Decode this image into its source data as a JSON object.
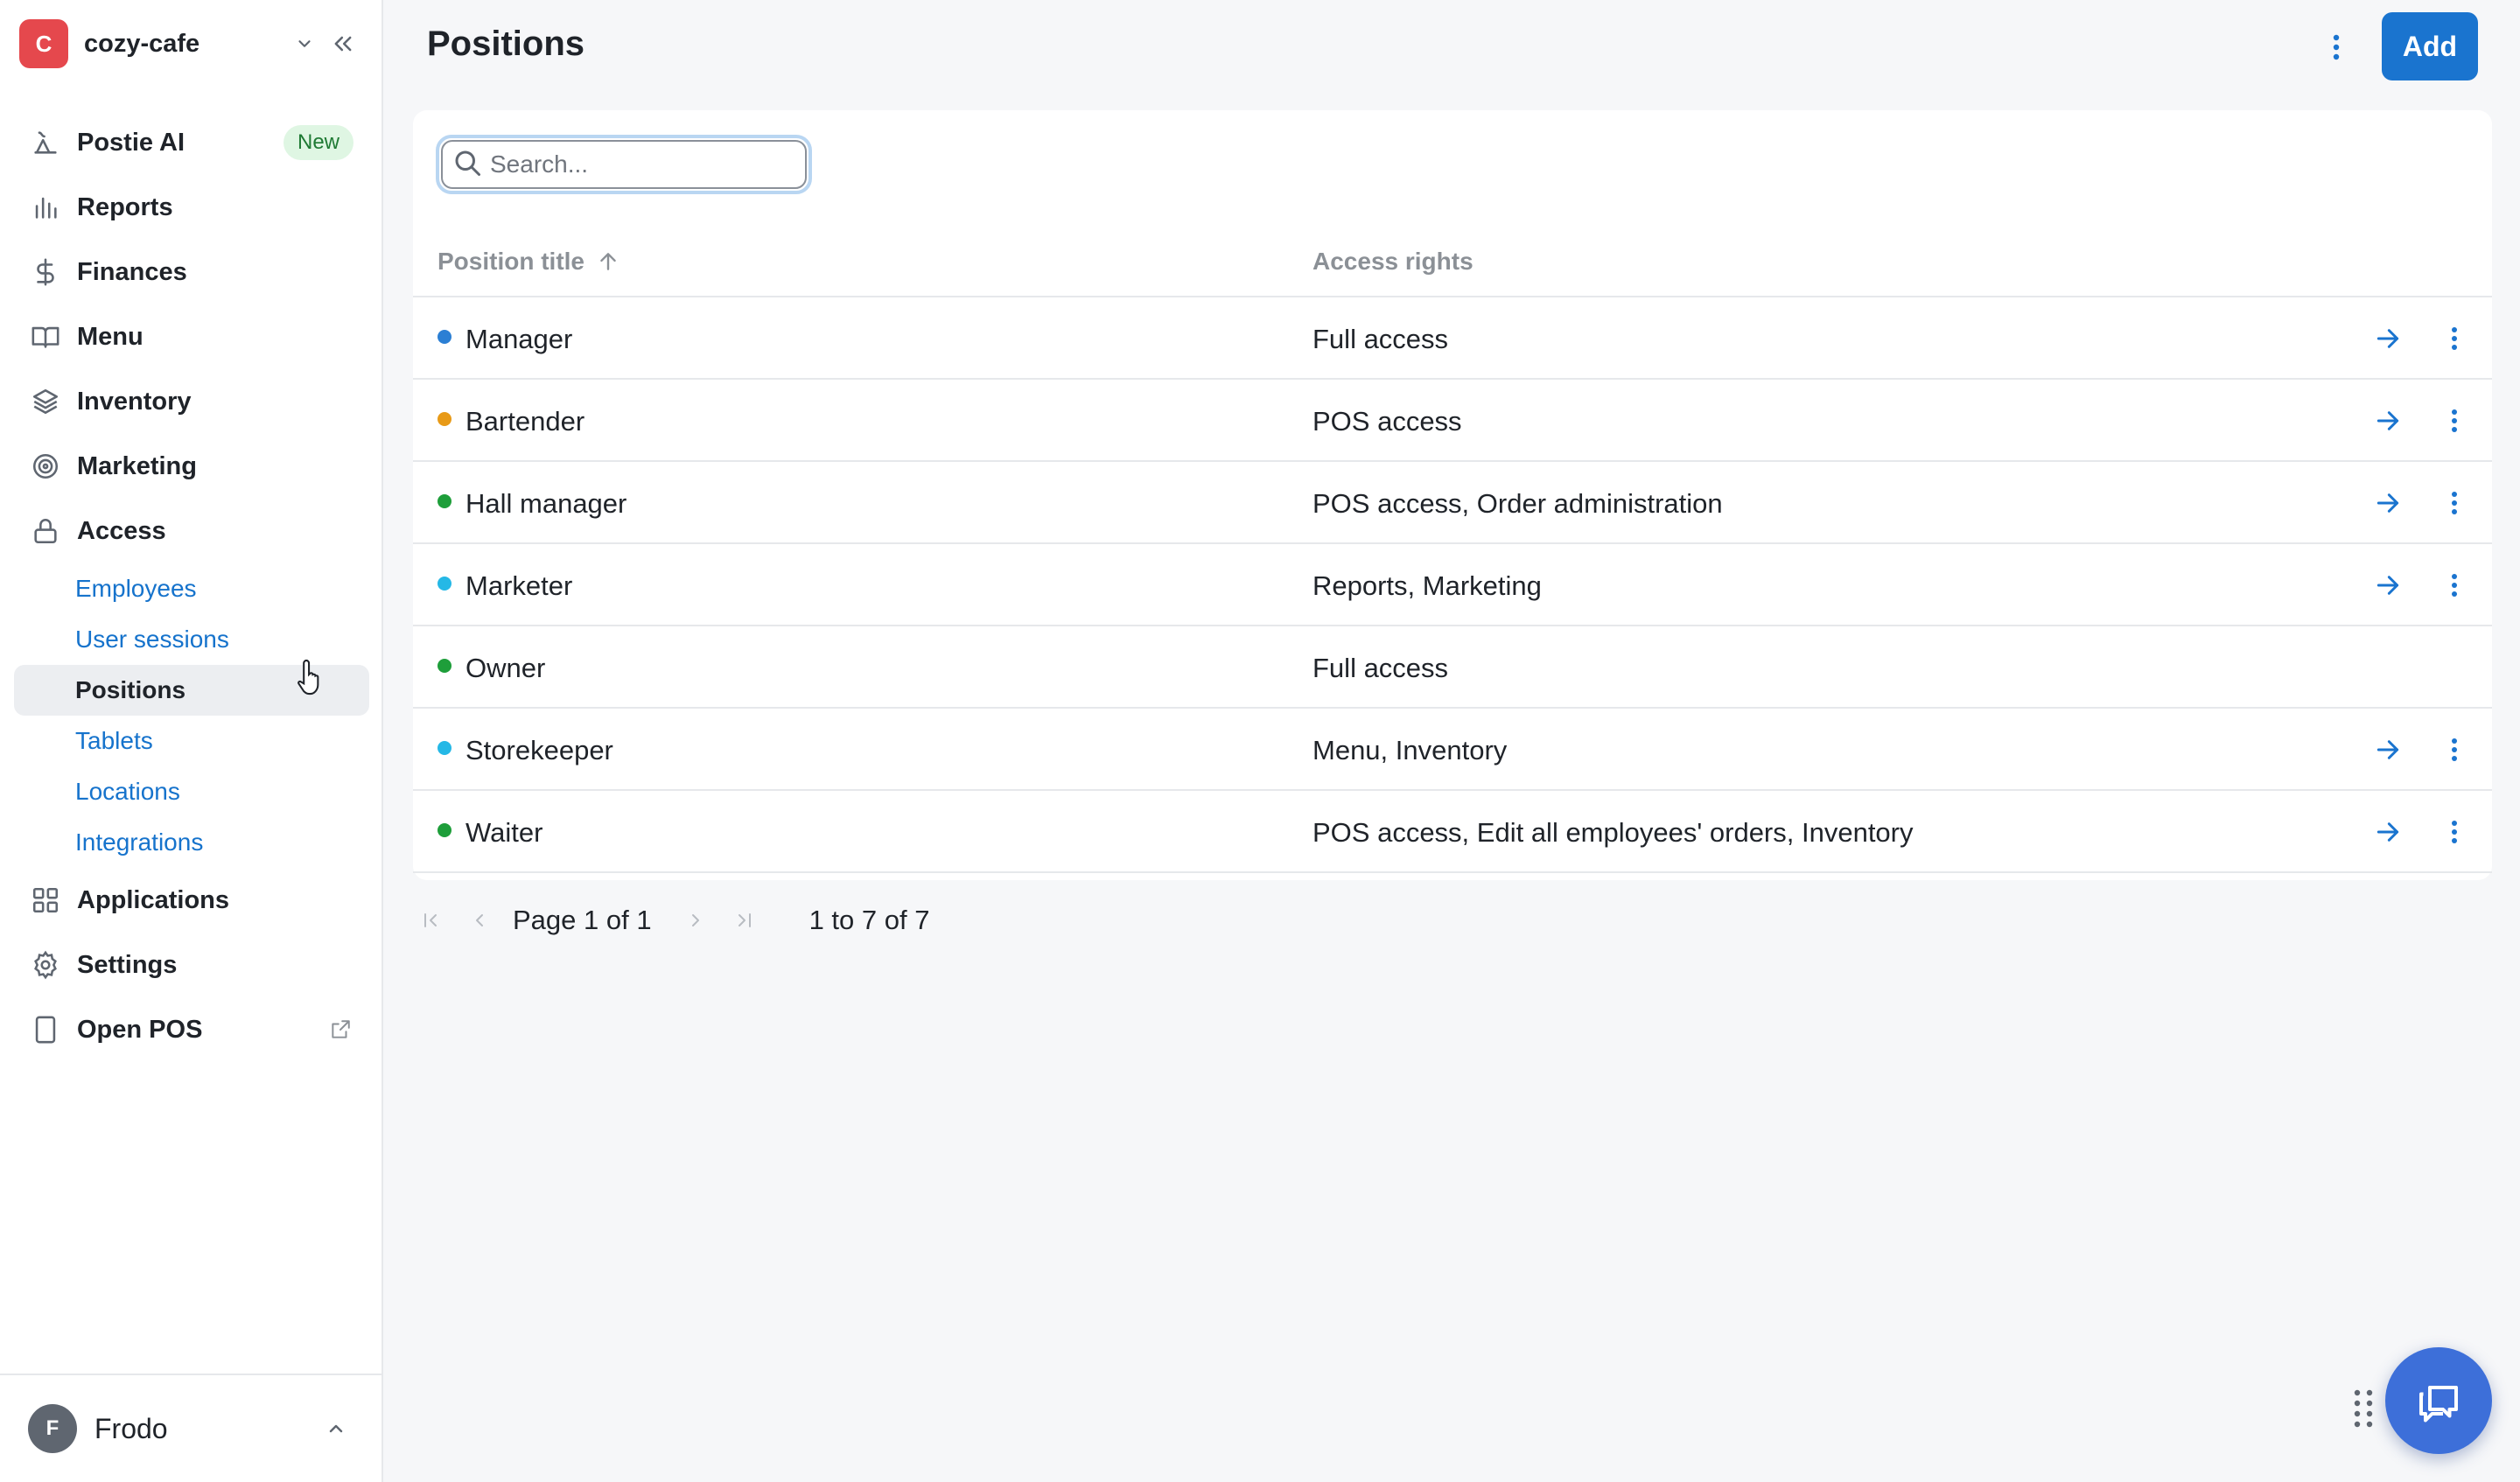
{
  "org": {
    "initial": "C",
    "name": "cozy-cafe"
  },
  "nav": {
    "postie": "Postie AI",
    "postie_badge": "New",
    "reports": "Reports",
    "finances": "Finances",
    "menu": "Menu",
    "inventory": "Inventory",
    "marketing": "Marketing",
    "access": "Access",
    "access_sub": [
      "Employees",
      "User sessions",
      "Positions",
      "Tablets",
      "Locations",
      "Integrations"
    ],
    "applications": "Applications",
    "settings": "Settings",
    "open_pos": "Open POS"
  },
  "user": {
    "initial": "F",
    "name": "Frodo"
  },
  "header": {
    "title": "Positions",
    "add_label": "Add"
  },
  "search": {
    "placeholder": "Search...",
    "value": ""
  },
  "table": {
    "columns": [
      "Position title",
      "Access rights"
    ],
    "rows": [
      {
        "title": "Manager",
        "access": "Full access",
        "color": "#2b7fd4",
        "actions": true
      },
      {
        "title": "Bartender",
        "access": "POS access",
        "color": "#e89a17",
        "actions": true
      },
      {
        "title": "Hall manager",
        "access": "POS access, Order administration",
        "color": "#1e9e3a",
        "actions": true
      },
      {
        "title": "Marketer",
        "access": "Reports, Marketing",
        "color": "#25b8e6",
        "actions": true
      },
      {
        "title": "Owner",
        "access": "Full access",
        "color": "#1e9e3a",
        "actions": false
      },
      {
        "title": "Storekeeper",
        "access": "Menu, Inventory",
        "color": "#25b8e6",
        "actions": true
      },
      {
        "title": "Waiter",
        "access": "POS access, Edit all employees' orders, Inventory",
        "color": "#1e9e3a",
        "actions": true
      }
    ]
  },
  "pagination": {
    "page_text": "Page 1 of 1",
    "range_text": "1 to 7 of 7"
  },
  "colors": {
    "accent": "#1a74cf",
    "link": "#1673cc",
    "new_badge_bg": "#dff6e3",
    "org_avatar": "#e5484d"
  }
}
